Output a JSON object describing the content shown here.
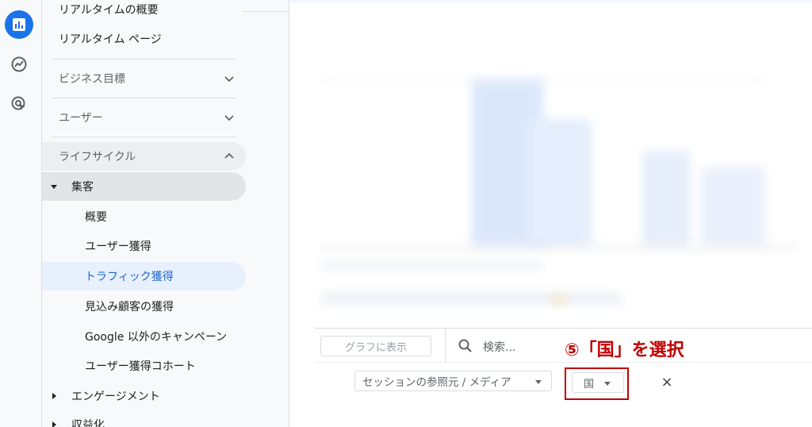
{
  "rail": {
    "icons": [
      "reports-icon",
      "explore-icon",
      "advertising-icon"
    ]
  },
  "nav": {
    "realtime_overview": "リアルタイムの概要",
    "realtime_page": "リアルタイム ページ",
    "business_goals": "ビジネス目標",
    "user": "ユーザー",
    "lifecycle": "ライフサイクル",
    "acquisition": "集客",
    "acq_overview": "概要",
    "user_acquisition": "ユーザー獲得",
    "traffic_acquisition": "トラフィック獲得",
    "lead_acquisition": "見込み顧客の獲得",
    "non_google_campaigns": "Google 以外のキャンペーン",
    "user_acq_cohort": "ユーザー獲得コホート",
    "engagement": "エンゲージメント",
    "monetization": "収益化"
  },
  "toolbar": {
    "graph_button": "グラフに表示",
    "search_placeholder": "検索..."
  },
  "table": {
    "dimension_select": "セッションの参照元 / メディア",
    "secondary_dimension": "国",
    "close": "×"
  },
  "annotation": {
    "text": "⑤「国」を選択"
  },
  "colors": {
    "accent": "#1a73e8",
    "annotation_red": "#c00000",
    "selected_bg": "#e8f0fe"
  }
}
